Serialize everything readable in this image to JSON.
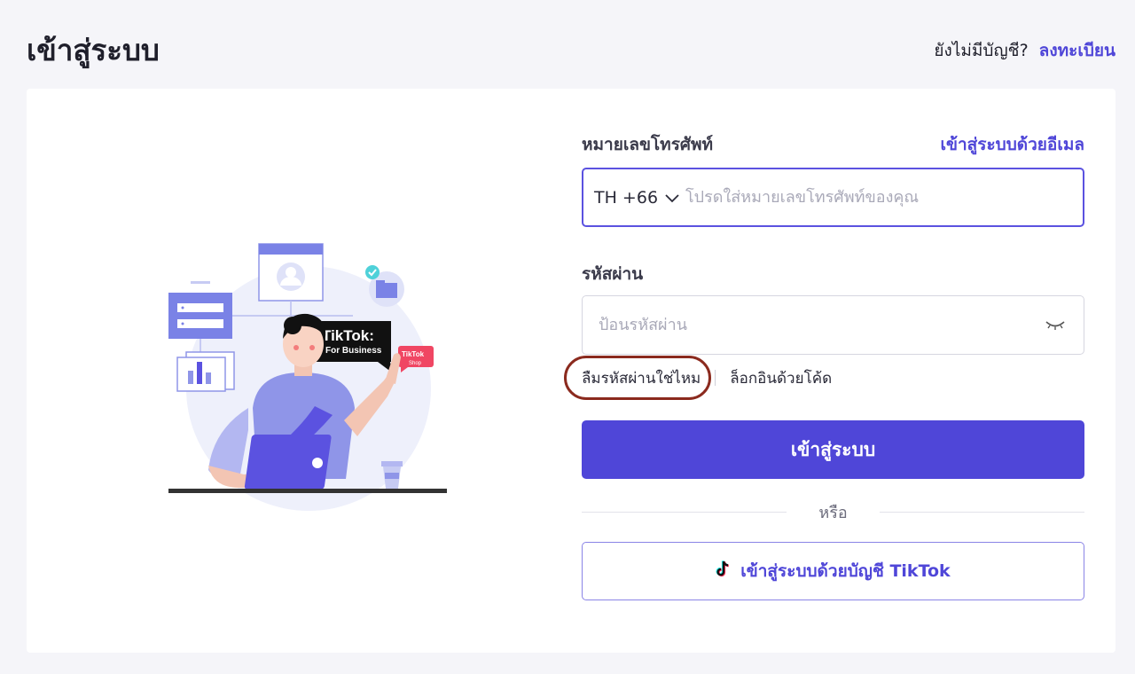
{
  "header": {
    "title": "เข้าสู่ระบบ",
    "signup_prompt": "ยังไม่มีบัญชี?",
    "signup_link": "ลงทะเบียน"
  },
  "illustration": {
    "brand_label": "TikTok:",
    "brand_sublabel": "For Business",
    "shop_label": "TikTok",
    "shop_sublabel": "Shop"
  },
  "form": {
    "phone_label": "หมายเลขโทรศัพท์",
    "email_login_link": "เข้าสู่ระบบด้วยอีเมล",
    "country_code": "TH +66",
    "phone_placeholder": "โปรดใส่หมายเลขโทรศัพท์ของคุณ",
    "password_label": "รหัสผ่าน",
    "password_placeholder": "ป้อนรหัสผ่าน",
    "forgot_password": "ลืมรหัสผ่านใช่ไหม",
    "code_login": "ล็อกอินด้วยโค้ด",
    "login_button": "เข้าสู่ระบบ",
    "or_text": "หรือ",
    "tiktok_login_button": "เข้าสู่ระบบด้วยบัญชี TikTok"
  },
  "colors": {
    "primary": "#4f46d8",
    "background": "#f5f5f9",
    "annotation": "#8b2a1e"
  }
}
